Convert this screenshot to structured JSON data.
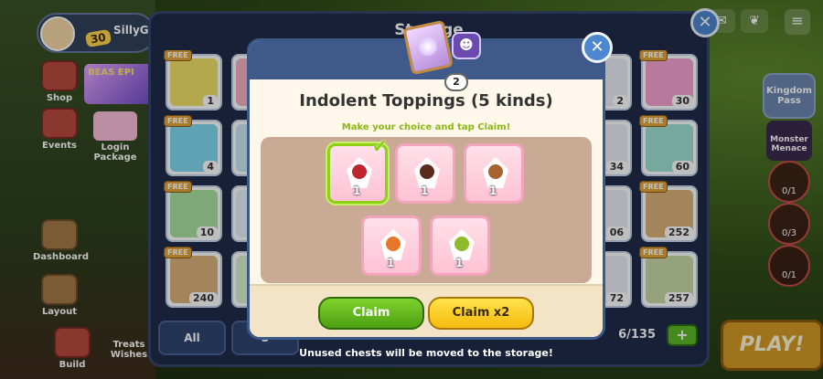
{
  "hud": {
    "player_name": "SillyG",
    "level": "30",
    "side_left": [
      {
        "label": "Shop"
      },
      {
        "label": "Events"
      },
      {
        "label": "Dashboard"
      },
      {
        "label": "Layout"
      },
      {
        "label": "Build"
      }
    ],
    "promo_text": "BEAS EPI",
    "login_package": "Login Package",
    "treats_wishes": "Treats Wishes",
    "kingdom_pass": "Kingdom Pass",
    "monster_menace": "Monster Menace",
    "quests": [
      "0/1",
      "0/3",
      "0/1"
    ],
    "play": "PLAY!",
    "menu_icon": "hamburger-icon"
  },
  "storage": {
    "title": "Storage",
    "close_icon": "close-icon",
    "left_slots": [
      {
        "free": "FREE",
        "count": "1",
        "color": "#f0e06a"
      },
      {
        "free": "FREE",
        "count": "4",
        "color": "#7fd8f0"
      },
      {
        "free": "FREE",
        "count": "10",
        "color": "#a9e0a0"
      },
      {
        "free": "FREE",
        "count": "240",
        "color": "#d9b27a"
      }
    ],
    "right_slots": [
      {
        "free": "FREE",
        "count": "30",
        "color": "#f5a2d0"
      },
      {
        "free": "FREE",
        "count": "60",
        "color": "#9ee0d2"
      },
      {
        "free": "FREE",
        "count": "252",
        "color": "#d9b27a"
      },
      {
        "free": "FREE",
        "count": "257",
        "color": "#c8d8a4"
      }
    ],
    "partial_counts": [
      "2",
      "34",
      "06",
      "72"
    ],
    "filter_all": "All",
    "filter_second": "S",
    "capacity": "6/135",
    "add_label": "+"
  },
  "dialog": {
    "chest_count": "2",
    "title": "Indolent Toppings (5 kinds)",
    "hint": "Make your choice and tap Claim!",
    "close_label": "✕",
    "badge_glyph": "☻",
    "options": [
      {
        "name": "raspberry-topping",
        "qty": "1",
        "color": "#c0262f",
        "selected": true
      },
      {
        "name": "chocolate-topping",
        "qty": "1",
        "color": "#5a2a1a",
        "selected": false
      },
      {
        "name": "almond-topping",
        "qty": "1",
        "color": "#a8642e",
        "selected": false
      },
      {
        "name": "caramel-topping",
        "qty": "1",
        "color": "#e8772a",
        "selected": false
      },
      {
        "name": "apple-jelly-topping",
        "qty": "1",
        "color": "#8fba2a",
        "selected": false
      }
    ],
    "claim": "Claim",
    "claim_x2": "Claim x2",
    "check_glyph": "✔"
  },
  "footer_note": "Unused chests will be moved to the storage!"
}
